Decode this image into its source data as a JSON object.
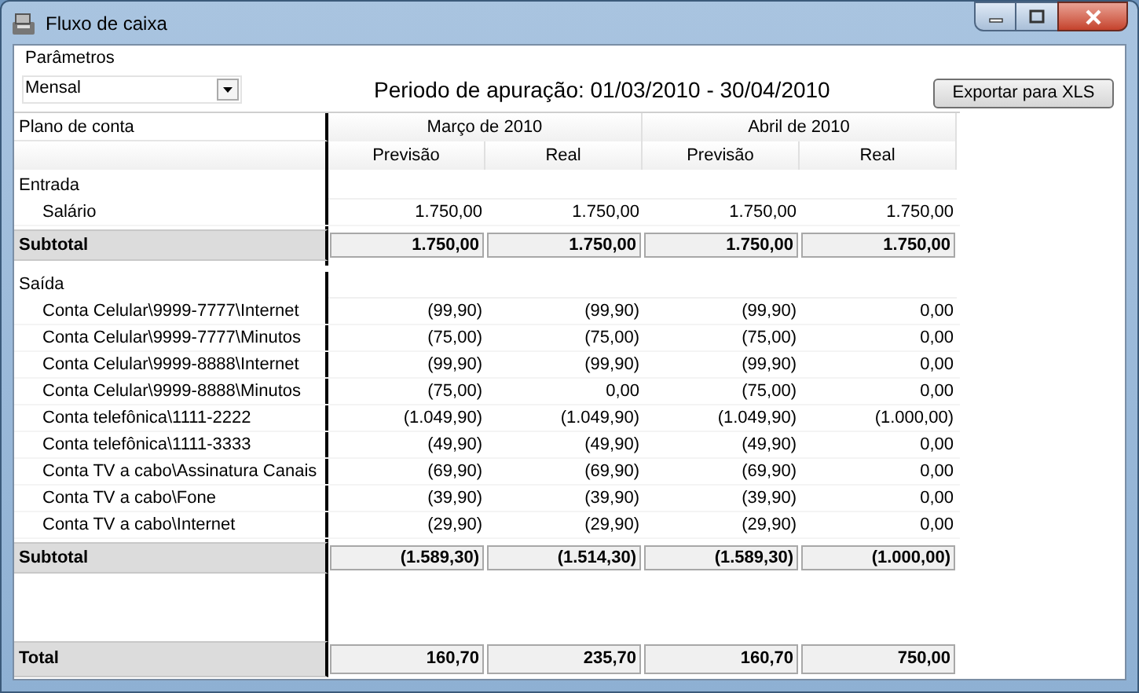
{
  "window": {
    "title": "Fluxo de caixa"
  },
  "parameters": {
    "label": "Parâmetros",
    "period_select": "Mensal",
    "period_text": "Periodo de apuração: 01/03/2010 - 30/04/2010",
    "export_button": "Exportar para XLS"
  },
  "table": {
    "first_column": "Plano de conta",
    "months": [
      {
        "label": "Março de 2010",
        "columns": [
          "Previsão",
          "Real"
        ]
      },
      {
        "label": "Abril de 2010",
        "columns": [
          "Previsão",
          "Real"
        ]
      }
    ],
    "rows": [
      {
        "kind": "group",
        "label": "Entrada"
      },
      {
        "kind": "item",
        "label": "Salário",
        "values": [
          "1.750,00",
          "1.750,00",
          "1.750,00",
          "1.750,00"
        ]
      },
      {
        "kind": "subtotal",
        "label": "Subtotal",
        "values": [
          "1.750,00",
          "1.750,00",
          "1.750,00",
          "1.750,00"
        ]
      },
      {
        "kind": "group",
        "label": "Saída"
      },
      {
        "kind": "item",
        "label": "Conta Celular\\9999-7777\\Internet",
        "values": [
          "(99,90)",
          "(99,90)",
          "(99,90)",
          "0,00"
        ]
      },
      {
        "kind": "item",
        "label": "Conta Celular\\9999-7777\\Minutos",
        "values": [
          "(75,00)",
          "(75,00)",
          "(75,00)",
          "0,00"
        ]
      },
      {
        "kind": "item",
        "label": "Conta Celular\\9999-8888\\Internet",
        "values": [
          "(99,90)",
          "(99,90)",
          "(99,90)",
          "0,00"
        ]
      },
      {
        "kind": "item",
        "label": "Conta Celular\\9999-8888\\Minutos",
        "values": [
          "(75,00)",
          "0,00",
          "(75,00)",
          "0,00"
        ]
      },
      {
        "kind": "item",
        "label": "Conta telefônica\\1111-2222",
        "values": [
          "(1.049,90)",
          "(1.049,90)",
          "(1.049,90)",
          "(1.000,00)"
        ]
      },
      {
        "kind": "item",
        "label": "Conta telefônica\\1111-3333",
        "values": [
          "(49,90)",
          "(49,90)",
          "(49,90)",
          "0,00"
        ]
      },
      {
        "kind": "item",
        "label": "Conta TV a cabo\\Assinatura Canais",
        "values": [
          "(69,90)",
          "(69,90)",
          "(69,90)",
          "0,00"
        ]
      },
      {
        "kind": "item",
        "label": "Conta TV a cabo\\Fone",
        "values": [
          "(39,90)",
          "(39,90)",
          "(39,90)",
          "0,00"
        ]
      },
      {
        "kind": "item",
        "label": "Conta TV a cabo\\Internet",
        "values": [
          "(29,90)",
          "(29,90)",
          "(29,90)",
          "0,00"
        ]
      },
      {
        "kind": "subtotal",
        "label": "Subtotal",
        "values": [
          "(1.589,30)",
          "(1.514,30)",
          "(1.589,30)",
          "(1.000,00)"
        ]
      },
      {
        "kind": "total",
        "label": "Total",
        "values": [
          "160,70",
          "235,70",
          "160,70",
          "750,00"
        ]
      }
    ]
  }
}
